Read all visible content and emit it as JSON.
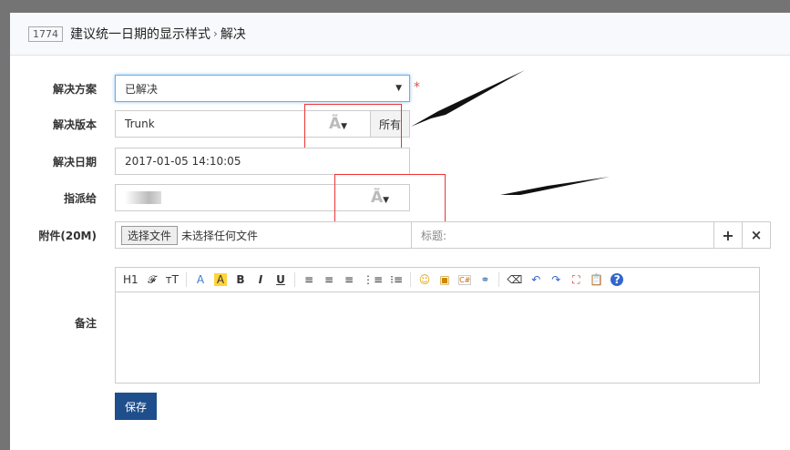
{
  "header": {
    "id": "1774",
    "title": "建议统一日期的显示样式",
    "sep": "›",
    "action": "解决"
  },
  "form": {
    "resolution": {
      "label": "解决方案",
      "value": "已解决",
      "required": "*"
    },
    "build": {
      "label": "解决版本",
      "value": "Trunk",
      "all_button": "所有",
      "chosen_icon": "Ã"
    },
    "date": {
      "label": "解决日期",
      "value": "2017-01-05 14:10:05"
    },
    "assign": {
      "label": "指派给",
      "value": "",
      "chosen_icon": "Ã"
    },
    "files": {
      "label": "附件(20M)",
      "choose": "选择文件",
      "nofile": "未选择任何文件",
      "title_label": "标题:",
      "add": "+",
      "remove": "×"
    },
    "comment": {
      "label": "备注"
    },
    "toolbar": [
      "H1",
      "𝓕",
      "тT",
      "A",
      "A",
      "B",
      "I",
      "U",
      "≡",
      "≡",
      "≡",
      "⋮≡",
      "⁝≡",
      "☺",
      "▣",
      "C#",
      "⚭",
      "⌫",
      "↶",
      "↷",
      "⛶",
      "📋",
      "?"
    ]
  },
  "save_label": "保存"
}
